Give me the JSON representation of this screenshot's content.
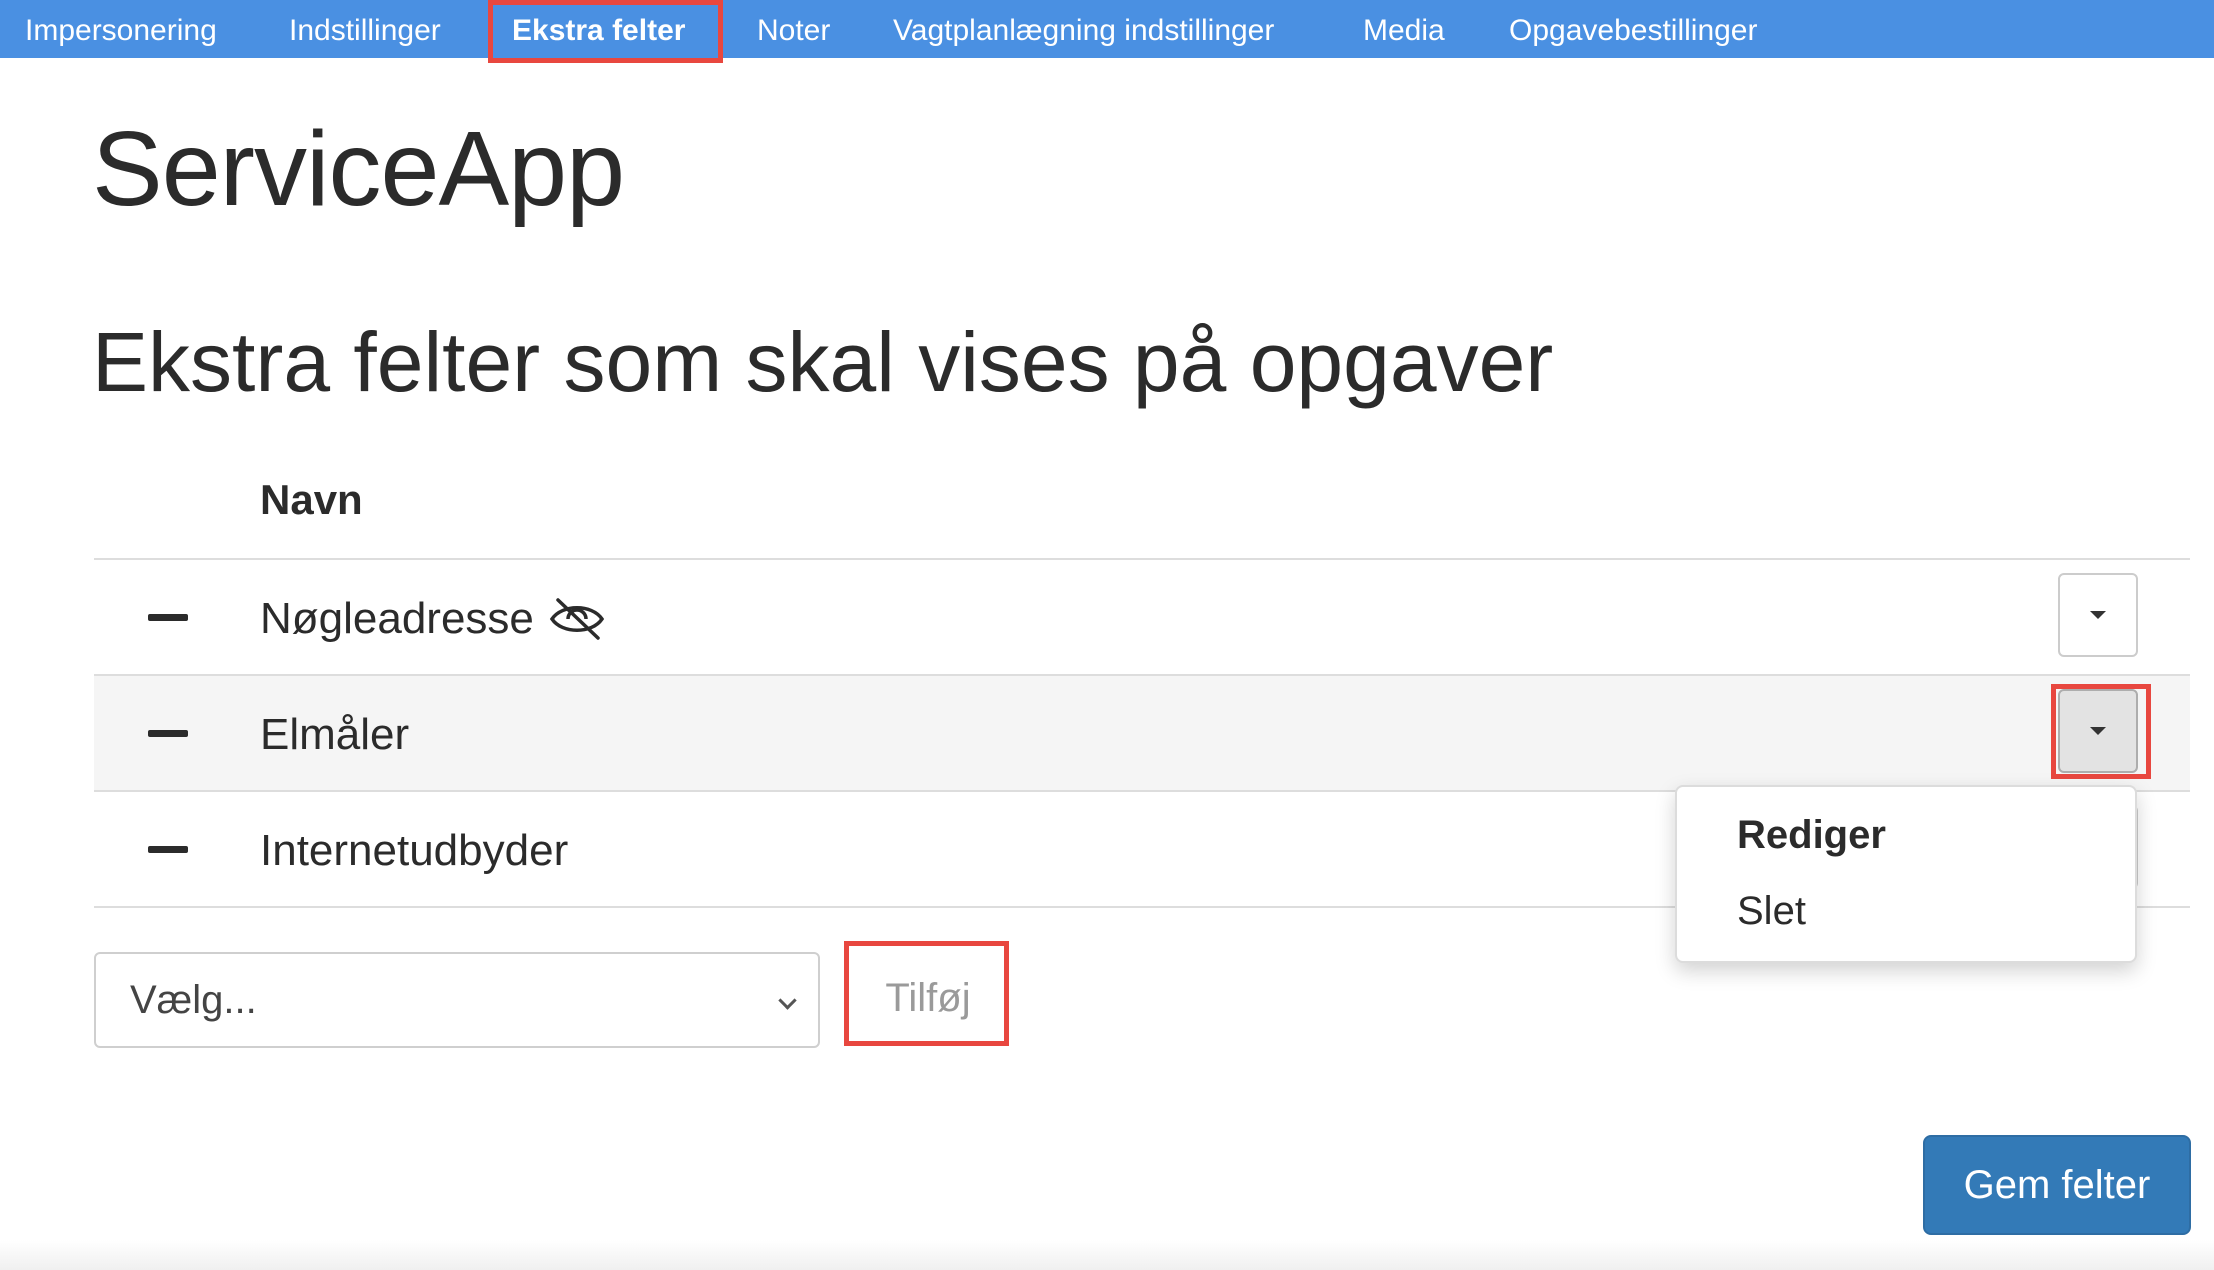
{
  "nav": {
    "items": [
      {
        "label": "Impersonering"
      },
      {
        "label": "Indstillinger"
      },
      {
        "label": "Ekstra felter"
      },
      {
        "label": "Noter"
      },
      {
        "label": "Vagtplanlægning indstillinger"
      },
      {
        "label": "Media"
      },
      {
        "label": "Opgavebestillinger"
      }
    ],
    "active_index": 2,
    "background_color": "#4a90e2"
  },
  "app_title": "ServiceApp",
  "page_heading": "Ekstra felter som skal vises på opgaver",
  "table": {
    "column_name": "Navn",
    "rows": [
      {
        "name": "Nøgleadresse",
        "hidden_icon": "eye-slash-icon"
      },
      {
        "name": "Elmåler"
      },
      {
        "name": "Internetudbyder"
      }
    ]
  },
  "row_menu": {
    "items": [
      {
        "label": "Rediger"
      },
      {
        "label": "Slet"
      }
    ]
  },
  "add_field": {
    "select_value": "Vælg...",
    "add_label": "Tilføj"
  },
  "save_label": "Gem felter",
  "colors": {
    "highlight": "#e8473f",
    "primary_button": "#337ab7"
  }
}
